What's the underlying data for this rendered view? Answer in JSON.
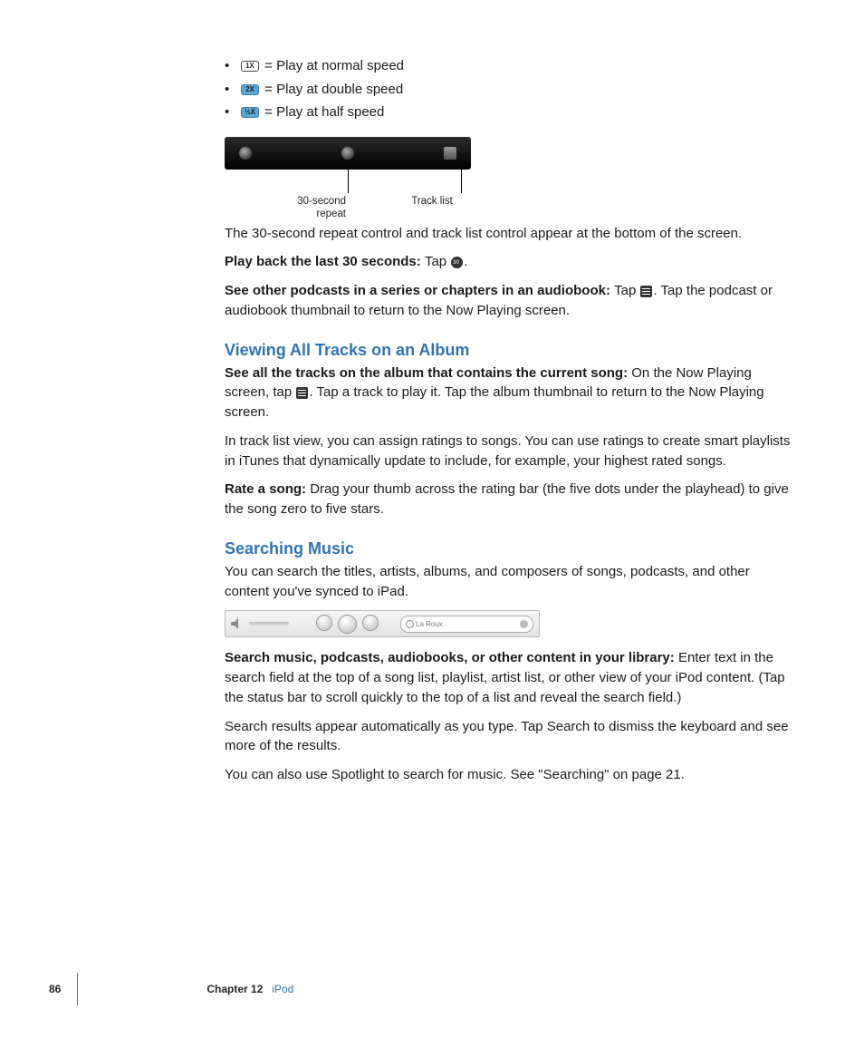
{
  "speed_items": [
    {
      "badge": "1X",
      "blue": false,
      "text": " = Play at normal speed"
    },
    {
      "badge": "2X",
      "blue": true,
      "text": " = Play at double speed"
    },
    {
      "badge": "½X",
      "blue": true,
      "text": " = Play at half speed"
    }
  ],
  "callout_repeat_l1": "30-second",
  "callout_repeat_l2": "repeat",
  "callout_tracklist": "Track list",
  "p_controls_appear": "The 30-second repeat control and track list control appear at the bottom of the screen.",
  "p_playback_bold": "Play back the last 30 seconds:  ",
  "p_playback_rest": "Tap ",
  "p_seeother_bold": "See other podcasts in a series or chapters in an audiobook: ",
  "p_seeother_mid": "Tap ",
  "p_seeother_rest": ". Tap the podcast or audiobook thumbnail to return to the Now Playing screen.",
  "h_viewing": "Viewing All Tracks on an Album",
  "p_seeall_bold": "See all the tracks on the album that contains the current song:  ",
  "p_seeall_mid": "On the Now Playing screen, tap ",
  "p_seeall_rest": ". Tap a track to play it. Tap the album thumbnail to return to the Now Playing screen.",
  "p_tracklistview": "In track list view, you can assign ratings to songs. You can use ratings to create smart playlists in iTunes that dynamically update to include, for example, your highest rated songs.",
  "p_rate_bold": "Rate a song:  ",
  "p_rate_rest": "Drag your thumb across the rating bar (the five dots under the playhead) to give the song zero to five stars.",
  "h_searching": "Searching Music",
  "p_searchintro": "You can search the titles, artists, albums, and composers of songs, podcasts, and other content you've synced to iPad.",
  "search_value": "La Roux",
  "p_searchlib_bold": "Search music, podcasts, audiobooks, or other content in your library:  ",
  "p_searchlib_rest": "Enter text in the search field at the top of a song list, playlist, artist list, or other view of your iPod content. (Tap the status bar to scroll quickly to the top of a list and reveal the search field.)",
  "p_searchresults": "Search results appear automatically as you type. Tap Search to dismiss the keyboard and see more of the results.",
  "p_spotlight": "You can also use Spotlight to search for music. See \"Searching\" on page 21.",
  "footer_page": "86",
  "footer_chapter": "Chapter 12",
  "footer_chapname": "iPod"
}
